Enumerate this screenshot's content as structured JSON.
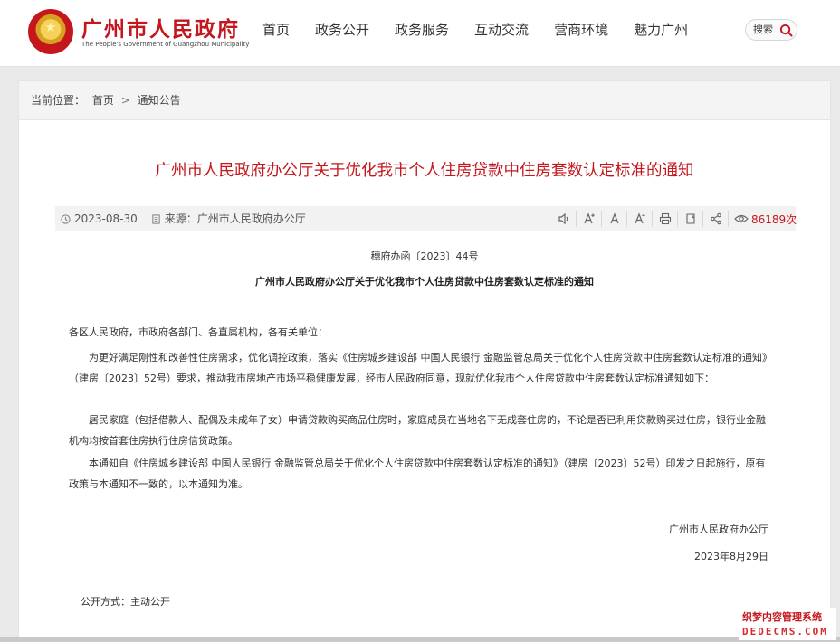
{
  "site": {
    "title": "广州市人民政府",
    "subtitle": "The People's Government of Guangzhou Municipality"
  },
  "nav": {
    "items": [
      "首页",
      "政务公开",
      "政务服务",
      "互动交流",
      "营商环境",
      "魅力广州"
    ]
  },
  "search": {
    "label": "搜索"
  },
  "breadcrumb": {
    "prefix": "当前位置：",
    "home": "首页",
    "separator": ">",
    "current": "通知公告"
  },
  "article": {
    "title": "广州市人民政府办公厅关于优化我市个人住房贷款中住房套数认定标准的通知",
    "date": "2023-08-30",
    "source": "来源：广州市人民政府办公厅",
    "views": "86189次",
    "doc_number": "穗府办函〔2023〕44号",
    "doc_subtitle": "广州市人民政府办公厅关于优化我市个人住房贷款中住房套数认定标准的通知",
    "paragraphs": [
      "各区人民政府，市政府各部门、各直属机构，各有关单位：",
      "为更好满足刚性和改善性住房需求，优化调控政策，落实《住房城乡建设部 中国人民银行 金融监管总局关于优化个人住房贷款中住房套数认定标准的通知》（建房〔2023〕52号）要求，推动我市房地产市场平稳健康发展，经市人民政府同意，现就优化我市个人住房贷款中住房套数认定标准通知如下：",
      "居民家庭（包括借款人、配偶及未成年子女）申请贷款购买商品住房时，家庭成员在当地名下无成套住房的，不论是否已利用贷款购买过住房，银行业金融机构均按首套住房执行住房信贷政策。",
      "本通知自《住房城乡建设部 中国人民银行 金融监管总局关于优化个人住房贷款中住房套数认定标准的通知》（建房〔2023〕52号）印发之日起施行，原有政策与本通知不一致的，以本通知为准。"
    ],
    "signature_org": "广州市人民政府办公厅",
    "signature_date": "2023年8月29日",
    "open_mode": "公开方式：主动公开"
  },
  "toolbar": {
    "icons": [
      "speaker-icon",
      "font-increase-icon",
      "font-normal-icon",
      "font-decrease-icon",
      "print-icon",
      "bookmark-icon",
      "share-icon",
      "eye-icon"
    ]
  },
  "watermark": {
    "line1": "织梦内容管理系统",
    "line2": "DEDECMS.COM"
  },
  "colors": {
    "brand_red": "#c4161c",
    "page_bg": "#eaeaea",
    "meta_bg": "#f2f2f2"
  }
}
